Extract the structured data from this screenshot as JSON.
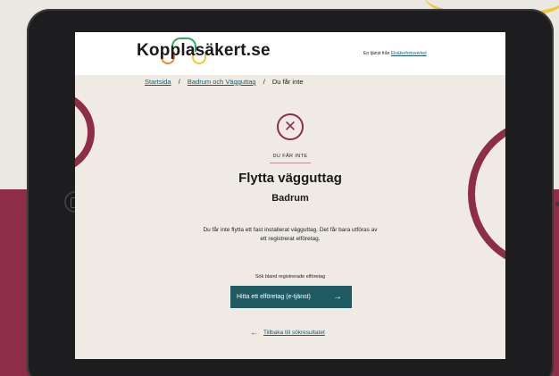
{
  "header": {
    "logo_text": "Kopplasäkert.se",
    "tagline_prefix": "En tjänst från",
    "tagline_link": "Elsäkerhetsverket"
  },
  "breadcrumb": {
    "items": [
      "Startsida",
      "Badrum och Vägguttag",
      "Du får inte"
    ],
    "separator": "/"
  },
  "status": {
    "icon": "close-icon",
    "icon_glyph": "✕",
    "label": "DU FÅR INTE"
  },
  "content": {
    "title": "Flytta vägguttag",
    "subtitle": "Badrum",
    "description": "Du får inte flytta ett fast installerat vägguttag. Det får bara utföras av ett registrerat elföretag."
  },
  "search": {
    "label": "Sök bland registrerade elföretag",
    "button_label": "Hitta ett elföretag (e-tjänst)",
    "button_arrow": "→"
  },
  "back": {
    "arrow": "←",
    "label": "Tillbaka till sökresultatet"
  },
  "colors": {
    "accent": "#8e2e46",
    "button": "#205a63",
    "link": "#1e5a6e",
    "background": "#efebe4"
  }
}
